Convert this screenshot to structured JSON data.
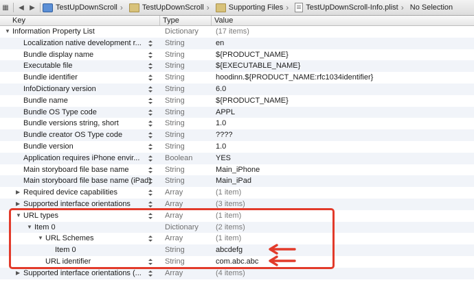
{
  "jumpbar": {
    "crumbs": [
      {
        "label": "TestUpDownScroll",
        "icon": "project-icon"
      },
      {
        "label": "TestUpDownScroll",
        "icon": "folder-icon"
      },
      {
        "label": "Supporting Files",
        "icon": "folder-icon"
      },
      {
        "label": "TestUpDownScroll-Info.plist",
        "icon": "plist-file-icon"
      },
      {
        "label": "No Selection",
        "icon": ""
      }
    ]
  },
  "columns": {
    "key": "Key",
    "type": "Type",
    "value": "Value"
  },
  "rows": [
    {
      "key": "Information Property List",
      "type": "Dictionary",
      "value": "(17 items)",
      "indent": 0,
      "disclosure": "expanded",
      "stepper": false,
      "muted_value": true
    },
    {
      "key": "Localization native development r...",
      "type": "String",
      "value": "en",
      "indent": 1,
      "disclosure": "none",
      "stepper": true
    },
    {
      "key": "Bundle display name",
      "type": "String",
      "value": "${PRODUCT_NAME}",
      "indent": 1,
      "disclosure": "none",
      "stepper": true
    },
    {
      "key": "Executable file",
      "type": "String",
      "value": "${EXECUTABLE_NAME}",
      "indent": 1,
      "disclosure": "none",
      "stepper": true
    },
    {
      "key": "Bundle identifier",
      "type": "String",
      "value": "hoodinn.${PRODUCT_NAME:rfc1034identifier}",
      "indent": 1,
      "disclosure": "none",
      "stepper": true
    },
    {
      "key": "InfoDictionary version",
      "type": "String",
      "value": "6.0",
      "indent": 1,
      "disclosure": "none",
      "stepper": true
    },
    {
      "key": "Bundle name",
      "type": "String",
      "value": "${PRODUCT_NAME}",
      "indent": 1,
      "disclosure": "none",
      "stepper": true
    },
    {
      "key": "Bundle OS Type code",
      "type": "String",
      "value": "APPL",
      "indent": 1,
      "disclosure": "none",
      "stepper": true
    },
    {
      "key": "Bundle versions string, short",
      "type": "String",
      "value": "1.0",
      "indent": 1,
      "disclosure": "none",
      "stepper": true
    },
    {
      "key": "Bundle creator OS Type code",
      "type": "String",
      "value": "????",
      "indent": 1,
      "disclosure": "none",
      "stepper": true
    },
    {
      "key": "Bundle version",
      "type": "String",
      "value": "1.0",
      "indent": 1,
      "disclosure": "none",
      "stepper": true
    },
    {
      "key": "Application requires iPhone envir...",
      "type": "Boolean",
      "value": "YES",
      "indent": 1,
      "disclosure": "none",
      "stepper": true
    },
    {
      "key": "Main storyboard file base name",
      "type": "String",
      "value": "Main_iPhone",
      "indent": 1,
      "disclosure": "none",
      "stepper": true
    },
    {
      "key": "Main storyboard file base name (iPad)",
      "type": "String",
      "value": "Main_iPad",
      "indent": 1,
      "disclosure": "none",
      "stepper": true
    },
    {
      "key": "Required device capabilities",
      "type": "Array",
      "value": "(1 item)",
      "indent": 1,
      "disclosure": "collapsed",
      "stepper": true,
      "muted_value": true
    },
    {
      "key": "Supported interface orientations",
      "type": "Array",
      "value": "(3 items)",
      "indent": 1,
      "disclosure": "collapsed",
      "stepper": true,
      "muted_value": true
    },
    {
      "key": "URL types",
      "type": "Array",
      "value": "(1 item)",
      "indent": 1,
      "disclosure": "expanded",
      "stepper": true,
      "muted_value": true
    },
    {
      "key": "Item 0",
      "type": "Dictionary",
      "value": "(2 items)",
      "indent": 2,
      "disclosure": "expanded",
      "stepper": false,
      "muted_value": true
    },
    {
      "key": "URL Schemes",
      "type": "Array",
      "value": "(1 item)",
      "indent": 3,
      "disclosure": "expanded",
      "stepper": true,
      "muted_value": true
    },
    {
      "key": "Item 0",
      "type": "String",
      "value": "abcdefg",
      "indent": 4,
      "disclosure": "none",
      "stepper": false
    },
    {
      "key": "URL identifier",
      "type": "String",
      "value": "com.abc.abc",
      "indent": 3,
      "disclosure": "none",
      "stepper": true
    },
    {
      "key": "Supported interface orientations (...",
      "type": "Array",
      "value": "(4 items)",
      "indent": 1,
      "disclosure": "collapsed",
      "stepper": true,
      "muted_value": true
    }
  ],
  "annotation_color": "#e23a2a"
}
